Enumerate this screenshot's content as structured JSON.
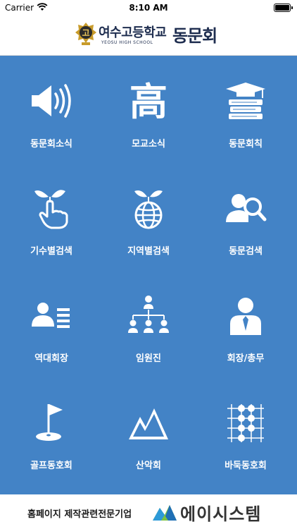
{
  "status_bar": {
    "carrier": "Carrier",
    "time": "8:10 AM"
  },
  "header": {
    "emblem_char": "고",
    "school_name": "여수고등학교",
    "school_sub": "YEOSU HIGH SCHOOL",
    "title": "동문회"
  },
  "menu": [
    {
      "label": "동문회소식",
      "icon": "speaker-icon"
    },
    {
      "label": "모교소식",
      "icon": "school-character-icon",
      "glyph": "高"
    },
    {
      "label": "동문회칙",
      "icon": "books-graduation-cap-icon"
    },
    {
      "label": "기수별검색",
      "icon": "sprout-hand-icon"
    },
    {
      "label": "지역별검색",
      "icon": "globe-sprout-icon"
    },
    {
      "label": "동문검색",
      "icon": "user-search-icon"
    },
    {
      "label": "역대회장",
      "icon": "user-list-icon"
    },
    {
      "label": "임원진",
      "icon": "org-chart-icon"
    },
    {
      "label": "회장/총무",
      "icon": "person-icon"
    },
    {
      "label": "골프동호회",
      "icon": "golf-flag-icon"
    },
    {
      "label": "산악회",
      "icon": "mountain-icon"
    },
    {
      "label": "바둑동호회",
      "icon": "baduk-board-icon"
    }
  ],
  "footer": {
    "text": "홈페이지 제작관련전문기업",
    "brand": "에이시스템"
  },
  "colors": {
    "menu_bg": "#4383c6",
    "header_text": "#1e2d4f"
  }
}
